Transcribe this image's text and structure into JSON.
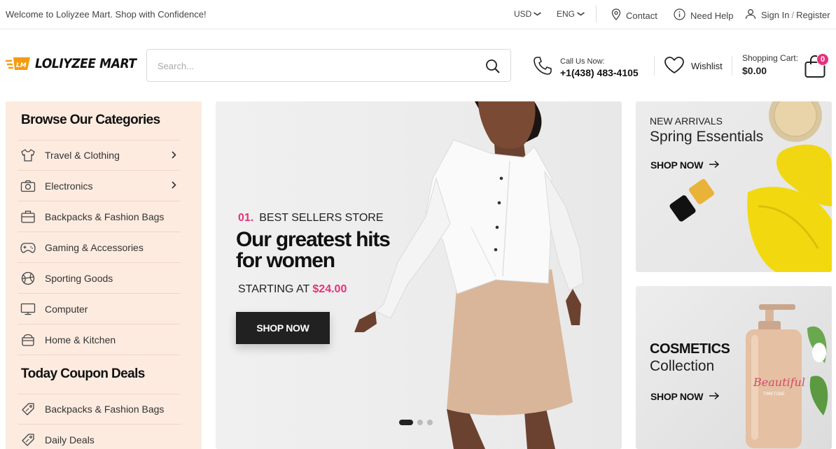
{
  "topbar": {
    "welcome": "Welcome to Loliyzee Mart. Shop with Confidence!",
    "currency": "USD",
    "language": "ENG",
    "contact": "Contact",
    "help": "Need Help",
    "signin": "Sign In",
    "register": "Register"
  },
  "header": {
    "logo_badge": "LM",
    "logo_text": "LOLIYZEE MART",
    "search_placeholder": "Search...",
    "call_label": "Call Us Now:",
    "call_number": "+1(438) 483-4105",
    "wishlist": "Wishlist",
    "cart_label": "Shopping Cart:",
    "cart_amount": "$0.00",
    "cart_count": "0"
  },
  "sidebar": {
    "categories_title": "Browse Our Categories",
    "categories": [
      {
        "label": "Travel & Clothing",
        "icon": "tshirt-icon",
        "has_sub": true
      },
      {
        "label": "Electronics",
        "icon": "camera-icon",
        "has_sub": true
      },
      {
        "label": "Backpacks & Fashion Bags",
        "icon": "bag-icon",
        "has_sub": false
      },
      {
        "label": "Gaming & Accessories",
        "icon": "gamepad-icon",
        "has_sub": false
      },
      {
        "label": "Sporting Goods",
        "icon": "ball-icon",
        "has_sub": false
      },
      {
        "label": "Computer",
        "icon": "monitor-icon",
        "has_sub": false
      },
      {
        "label": "Home & Kitchen",
        "icon": "pot-icon",
        "has_sub": false
      }
    ],
    "deals_title": "Today Coupon Deals",
    "deals": [
      {
        "label": "Backpacks & Fashion Bags",
        "icon": "tag-icon"
      },
      {
        "label": "Daily Deals",
        "icon": "tag-icon"
      }
    ]
  },
  "hero": {
    "number": "01.",
    "eyebrow": "BEST SELLERS STORE",
    "headline": "Our greatest hits for women",
    "starting_at": "STARTING AT",
    "price": "$24.00",
    "cta": "SHOP NOW",
    "slides": 3,
    "active_slide": 1
  },
  "banners": {
    "b1_small": "NEW ARRIVALS",
    "b1_big": "Spring Essentials",
    "b1_cta": "SHOP NOW",
    "b2_bold": "COSMETICS",
    "b2_big": "Collection",
    "b2_cta": "SHOP NOW",
    "bottle_text": "Beautiful",
    "bottle_sub": "TIMETOBE"
  },
  "colors": {
    "accent": "#e5337b",
    "logo_orange": "#f39c12",
    "sidebar_bg": "#fdebe0",
    "button_dark": "#212121"
  }
}
